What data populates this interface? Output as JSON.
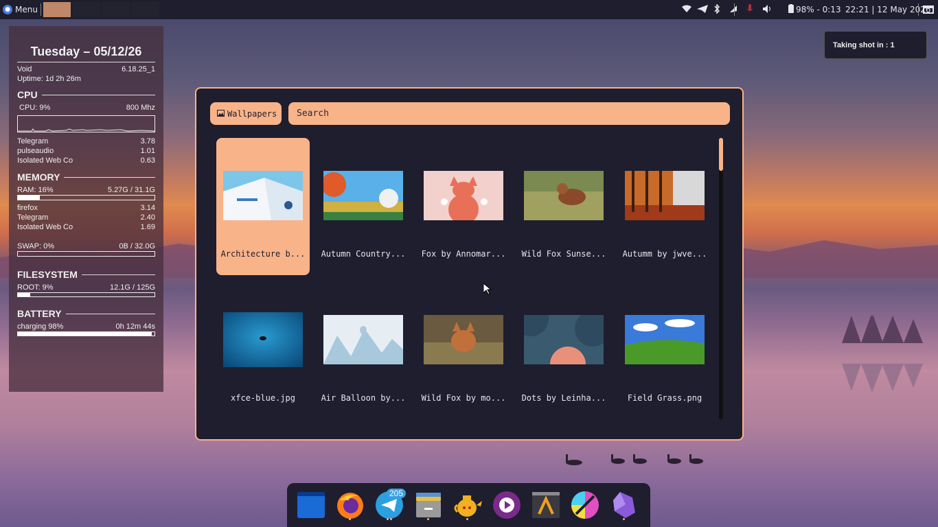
{
  "panel": {
    "menu_label": "Menu",
    "battery": "98% - 0:13",
    "clock": "22:21 | 12 May 2026"
  },
  "conky": {
    "date": "Tuesday – 05/12/26",
    "os_name": "Void",
    "kernel": "6.18.25_1",
    "uptime": "Uptime: 1d 2h 26m",
    "cpu": {
      "title": "CPU",
      "usage": "CPU: 9%",
      "freq": "800 Mhz",
      "procs": [
        {
          "name": "Telegram",
          "value": "3.78"
        },
        {
          "name": "pulseaudio",
          "value": "1.01"
        },
        {
          "name": "Isolated Web Co",
          "value": "0.63"
        }
      ]
    },
    "memory": {
      "title": "MEMORY",
      "ram_label": "RAM: 16%",
      "ram_value": "5.27G / 31.1G",
      "ram_fraction": 0.16,
      "procs": [
        {
          "name": "firefox",
          "value": "3.14"
        },
        {
          "name": "Telegram",
          "value": "2.40"
        },
        {
          "name": "Isolated Web Co",
          "value": "1.69"
        }
      ],
      "swap_label": "SWAP: 0%",
      "swap_value": "0B / 32.0G",
      "swap_fraction": 0.0
    },
    "filesystem": {
      "title": "FILESYSTEM",
      "root_label": "ROOT:  9%",
      "root_value": "12.1G / 125G",
      "root_fraction": 0.09
    },
    "battery": {
      "title": "BATTERY",
      "label": "charging 98%",
      "value": "0h 12m 44s",
      "fraction": 0.98
    }
  },
  "notification": {
    "text": "Taking shot in : 1"
  },
  "picker": {
    "mode_label": "Wallpapers",
    "search_placeholder": "Search",
    "items": [
      {
        "label": "Architecture b...",
        "selected": true
      },
      {
        "label": "Autumn Country..."
      },
      {
        "label": "Fox by Annomar..."
      },
      {
        "label": "Wild Fox Sunse..."
      },
      {
        "label": "Autumm by jwve..."
      },
      {
        "label": "xfce-blue.jpg"
      },
      {
        "label": "Air Balloon by..."
      },
      {
        "label": "Wild Fox by mo..."
      },
      {
        "label": "Dots by Leinha..."
      },
      {
        "label": "Field Grass.png"
      }
    ]
  },
  "dock": {
    "items": [
      "files-window",
      "firefox",
      "telegram",
      "file-manager",
      "teapot-app",
      "media-player",
      "text-editor",
      "krita",
      "obsidian"
    ],
    "telegram_badge": "205"
  },
  "colors": {
    "accent": "#f9b389",
    "panel_bg": "#1e1e2e"
  }
}
